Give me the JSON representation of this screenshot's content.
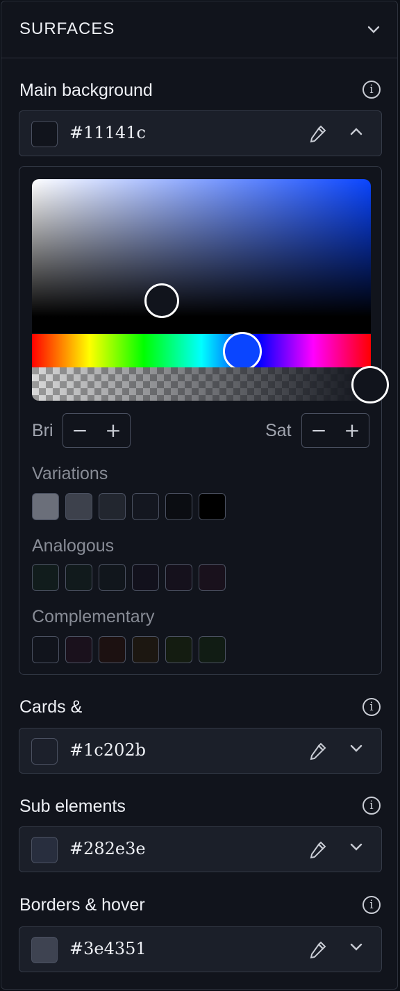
{
  "header": {
    "title": "SURFACES",
    "chevron_icon": "chevron-down-icon"
  },
  "fields": [
    {
      "label": "Main background",
      "hex": "#11141c",
      "swatch_color": "#11141c",
      "expanded": true
    },
    {
      "label": "Cards &",
      "hex": "#1c202b",
      "swatch_color": "#1c202b",
      "expanded": false
    },
    {
      "label": "Sub elements",
      "hex": "#282e3e",
      "swatch_color": "#282e3e",
      "expanded": false
    },
    {
      "label": "Borders & hover",
      "hex": "#3e4351",
      "swatch_color": "#3e4351",
      "expanded": false
    }
  ],
  "info_icon_glyph": "i",
  "picker": {
    "hue_color": "#0a45ff",
    "brightness_label": "Bri",
    "saturation_label": "Sat",
    "minus": "−",
    "plus": "+",
    "groups": [
      {
        "title": "Variations",
        "colors": [
          "#6b6f7a",
          "#3d414c",
          "#22262f",
          "#141720",
          "#0b0d12",
          "#000000"
        ]
      },
      {
        "title": "Analogous",
        "colors": [
          "#111c1c",
          "#111a1c",
          "#11161c",
          "#12111c",
          "#15111c",
          "#19111c"
        ]
      },
      {
        "title": "Complementary",
        "colors": [
          "#11141c",
          "#1a111c",
          "#1c1111",
          "#1c1711",
          "#141c11",
          "#111c14"
        ]
      }
    ]
  }
}
